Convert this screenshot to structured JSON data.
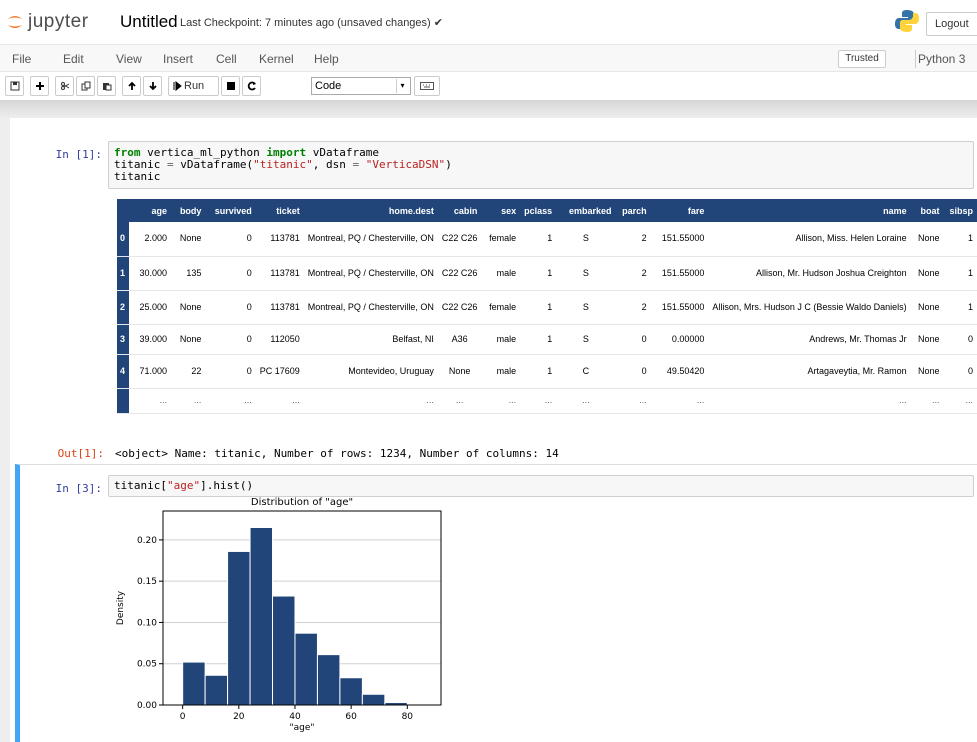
{
  "header": {
    "logo_text": "jupyter",
    "notebook_name": "Untitled",
    "checkpoint": "Last Checkpoint: 7 minutes ago  (unsaved changes) ✔",
    "logout": "Logout",
    "kernel_logo": "python-logo-icon"
  },
  "menubar": {
    "items": [
      "File",
      "Edit",
      "View",
      "Insert",
      "Cell",
      "Kernel",
      "Help"
    ],
    "trusted": "Trusted",
    "kernel": "Python 3"
  },
  "toolbar": {
    "run_label": "Run",
    "cell_type": "Code",
    "icons": [
      "save-icon",
      "add-cell-icon",
      "cut-icon",
      "copy-icon",
      "paste-icon",
      "move-up-icon",
      "move-down-icon",
      "run-icon",
      "stop-icon",
      "restart-icon",
      "command-palette-icon"
    ]
  },
  "cell1": {
    "in_prompt": "In [1]:",
    "out_prompt": "Out[1]:",
    "out_text": "<object> Name: titanic, Number of rows: 1234, Number of columns: 14"
  },
  "dataframe": {
    "columns": [
      "",
      "age",
      "body",
      "survived",
      "ticket",
      "home.dest",
      "cabin",
      "sex",
      "pclass",
      "embarked",
      "parch",
      "fare",
      "name",
      "boat",
      "sibsp"
    ],
    "rows": [
      [
        "0",
        "2.000",
        "None",
        "0",
        "113781",
        "Montreal, PQ / Chesterville, ON",
        "C22 C26",
        "female",
        "1",
        "S",
        "2",
        "151.55000",
        "Allison, Miss. Helen Loraine",
        "None",
        "1"
      ],
      [
        "1",
        "30.000",
        "135",
        "0",
        "113781",
        "Montreal, PQ / Chesterville, ON",
        "C22 C26",
        "male",
        "1",
        "S",
        "2",
        "151.55000",
        "Allison, Mr. Hudson Joshua Creighton",
        "None",
        "1"
      ],
      [
        "2",
        "25.000",
        "None",
        "0",
        "113781",
        "Montreal, PQ / Chesterville, ON",
        "C22 C26",
        "female",
        "1",
        "S",
        "2",
        "151.55000",
        "Allison, Mrs. Hudson J C (Bessie Waldo Daniels)",
        "None",
        "1"
      ],
      [
        "3",
        "39.000",
        "None",
        "0",
        "112050",
        "Belfast, NI",
        "A36",
        "male",
        "1",
        "S",
        "0",
        "0.00000",
        "Andrews, Mr. Thomas Jr",
        "None",
        "0"
      ],
      [
        "4",
        "71.000",
        "22",
        "0",
        "PC 17609",
        "Montevideo, Uruguay",
        "None",
        "male",
        "1",
        "C",
        "0",
        "49.50420",
        "Artagaveytia, Mr. Ramon",
        "None",
        "0"
      ],
      [
        "",
        "...",
        "...",
        "...",
        "...",
        "...",
        "...",
        "...",
        "...",
        "...",
        "...",
        "...",
        "...",
        "...",
        "..."
      ]
    ]
  },
  "cell2": {
    "in_prompt": "In [3]:"
  },
  "chart_data": {
    "type": "bar",
    "title": "Distribution of \"age\"",
    "xlabel": "\"age\"",
    "ylabel": "Density",
    "bins": [
      [
        0,
        8
      ],
      [
        8,
        16
      ],
      [
        16,
        24
      ],
      [
        24,
        32
      ],
      [
        32,
        40
      ],
      [
        40,
        48
      ],
      [
        48,
        56
      ],
      [
        56,
        64
      ],
      [
        64,
        72
      ],
      [
        72,
        80
      ],
      [
        80,
        88
      ]
    ],
    "values": [
      0.052,
      0.036,
      0.186,
      0.215,
      0.132,
      0.087,
      0.061,
      0.033,
      0.013,
      0.003,
      0.001
    ],
    "xlim": [
      -7,
      92
    ],
    "ylim": [
      0,
      0.235
    ],
    "xticks": [
      0,
      20,
      40,
      60,
      80
    ],
    "yticks": [
      "0.00",
      "0.05",
      "0.10",
      "0.15",
      "0.20"
    ],
    "color": "#214579",
    "grid": "y"
  }
}
